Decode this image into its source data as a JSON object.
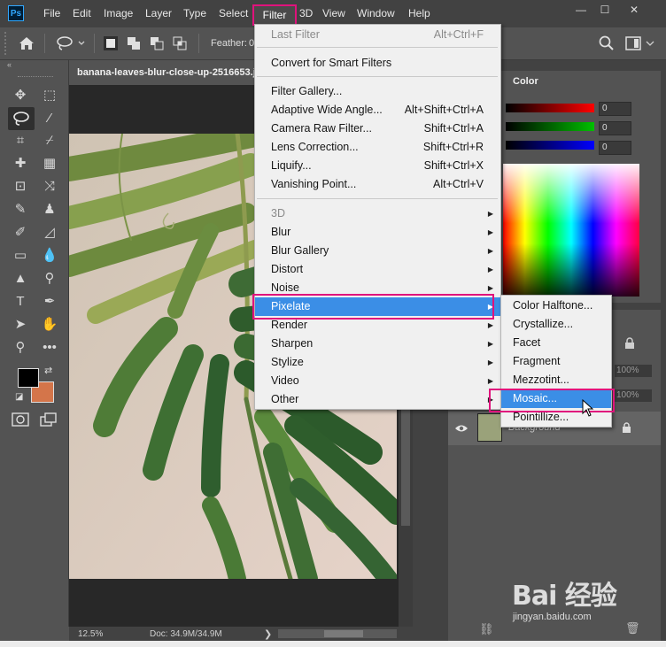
{
  "app": {
    "logo": "Ps"
  },
  "menubar": {
    "items": [
      "File",
      "Edit",
      "Image",
      "Layer",
      "Type",
      "Select",
      "Filter",
      "3D",
      "View",
      "Window",
      "Help"
    ]
  },
  "window_controls": {
    "minimize": "—",
    "restore": "☐",
    "close": "✕"
  },
  "options_bar": {
    "feather_label": "Feather:",
    "feather_value": "0"
  },
  "document": {
    "tab_title": "banana-leaves-blur-close-up-2516653.j"
  },
  "status_bar": {
    "zoom": "12.5%",
    "doc_info": "Doc: 34.9M/34.9M"
  },
  "color_panel": {
    "tab_label": "Color",
    "channels": [
      {
        "value": "0",
        "color": "#ff0000"
      },
      {
        "value": "0",
        "color": "#00c000"
      },
      {
        "value": "0",
        "color": "#0000ff"
      }
    ]
  },
  "layers_panel": {
    "opacity_value": "100%",
    "fill_value": "100%",
    "layer_name": "Background"
  },
  "filter_menu": {
    "items": [
      {
        "label": "Last Filter",
        "shortcut": "Alt+Ctrl+F",
        "disabled": true
      },
      {
        "label": "Convert for Smart Filters"
      },
      {
        "label": "Filter Gallery..."
      },
      {
        "label": "Adaptive Wide Angle...",
        "shortcut": "Alt+Shift+Ctrl+A"
      },
      {
        "label": "Camera Raw Filter...",
        "shortcut": "Shift+Ctrl+A"
      },
      {
        "label": "Lens Correction...",
        "shortcut": "Shift+Ctrl+R"
      },
      {
        "label": "Liquify...",
        "shortcut": "Shift+Ctrl+X"
      },
      {
        "label": "Vanishing Point...",
        "shortcut": "Alt+Ctrl+V"
      },
      {
        "label": "3D",
        "disabled": true,
        "submenu": true
      },
      {
        "label": "Blur",
        "submenu": true
      },
      {
        "label": "Blur Gallery",
        "submenu": true
      },
      {
        "label": "Distort",
        "submenu": true
      },
      {
        "label": "Noise",
        "submenu": true
      },
      {
        "label": "Pixelate",
        "submenu": true,
        "highlighted": true
      },
      {
        "label": "Render",
        "submenu": true
      },
      {
        "label": "Sharpen",
        "submenu": true
      },
      {
        "label": "Stylize",
        "submenu": true
      },
      {
        "label": "Video",
        "submenu": true
      },
      {
        "label": "Other",
        "submenu": true
      }
    ]
  },
  "pixelate_menu": {
    "items": [
      {
        "label": "Color Halftone..."
      },
      {
        "label": "Crystallize..."
      },
      {
        "label": "Facet"
      },
      {
        "label": "Fragment"
      },
      {
        "label": "Mezzotint..."
      },
      {
        "label": "Mosaic...",
        "highlighted": true
      },
      {
        "label": "Pointillize..."
      }
    ]
  },
  "watermark": {
    "logo": "Bai 经验",
    "url": "jingyan.baidu.com"
  },
  "colors": {
    "menu_highlight": "#3b8ee6",
    "annotation": "#e0127c",
    "background_swatch": "#d4754a",
    "foreground_swatch": "#000000"
  }
}
